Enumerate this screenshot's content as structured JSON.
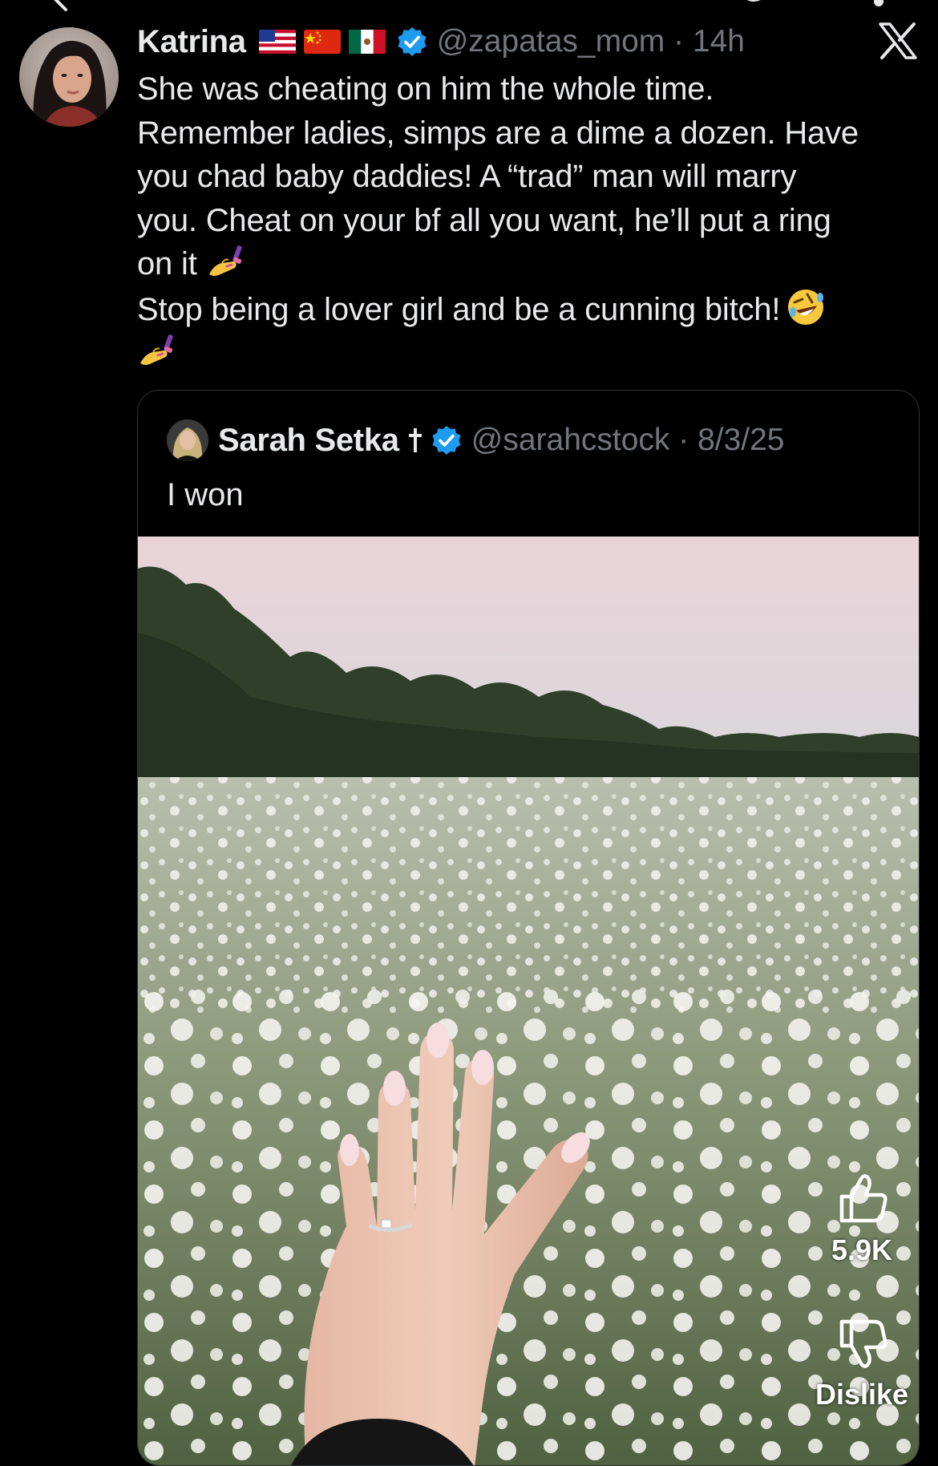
{
  "tweet": {
    "author": {
      "display_name": "Katrina",
      "flags": [
        "us-flag-icon",
        "china-flag-icon",
        "mexico-flag-icon"
      ],
      "handle": "@zapatas_mom",
      "timestamp": "14h",
      "handle_time": "@zapatas_mom · 14h"
    },
    "text_lines": [
      "She was cheating on him the whole time.",
      "Remember ladies, simps are a dime a dozen. Have",
      "you chad baby daddies! A “trad” man will marry",
      "you. Cheat on your bf all you want, he’ll put a ring",
      "on it",
      "Stop being a lover girl and be a cunning bitch!"
    ],
    "emojis": [
      "nail-polish-icon",
      "rofl-face-icon",
      "nail-polish-icon"
    ]
  },
  "quote": {
    "display_name": "Sarah Setka",
    "handle": "@sarahcstock",
    "date": "8/3/25",
    "handle_date": "@sarahcstock · 8/3/25",
    "text": "I won",
    "media": "photo of hand with engagement ring in field of white flowers"
  },
  "reactions": {
    "like_count": "5.9K",
    "dislike_label": "Dislike"
  },
  "colors": {
    "background": "#000000",
    "text_primary": "#e7e9ea",
    "text_secondary": "#71767b",
    "verified_blue": "#1d9bf0",
    "card_border": "#2f3336"
  }
}
